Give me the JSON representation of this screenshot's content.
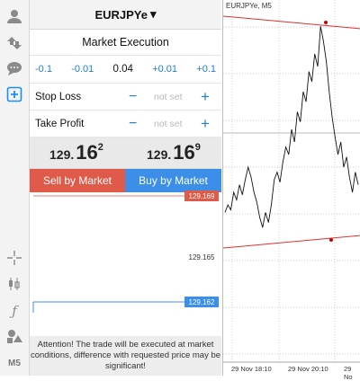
{
  "toolbar": {
    "icons": [
      "user-icon",
      "transfer-icon",
      "chat-icon",
      "new-order-icon",
      "crosshair-icon",
      "candles-icon",
      "function-icon",
      "objects-icon"
    ],
    "timeframe": "M5"
  },
  "order": {
    "symbol": "EURJPYe",
    "dropdown_glyph": "▾",
    "execution": "Market Execution",
    "volume_steps": {
      "minus_big": "-0.1",
      "minus_small": "-0.01",
      "value": "0.04",
      "plus_small": "+0.01",
      "plus_big": "+0.1"
    },
    "stop_loss": {
      "label": "Stop Loss",
      "value": "not set",
      "minus": "−",
      "plus": "+"
    },
    "take_profit": {
      "label": "Take Profit",
      "value": "not set",
      "minus": "−",
      "plus": "+"
    },
    "bid": {
      "main": "129.",
      "big": "16",
      "sup": "2"
    },
    "ask": {
      "main": "129.",
      "big": "16",
      "sup": "9"
    },
    "sell_label": "Sell by Market",
    "buy_label": "Buy by Market",
    "mini_levels": {
      "ask": "129.169",
      "mid": "129.165",
      "bid": "129.162"
    },
    "notice": "Attention! The trade will be executed at market conditions, difference with requested price may be significant!"
  },
  "colors": {
    "sell": "#e05a4a",
    "buy": "#3b8fe8",
    "accent": "#1a7fd9"
  },
  "chart": {
    "title": "EURJPYe, M5",
    "x_labels": [
      "29 Nov 18:10",
      "29 Nov 20:10",
      "29 No"
    ]
  },
  "chart_data": {
    "type": "line",
    "title": "EURJPYe, M5",
    "x_ticks": [
      "29 Nov 18:10",
      "29 Nov 20:10"
    ],
    "series": [
      {
        "values": [
          0.22,
          0.25,
          0.23,
          0.3,
          0.27,
          0.33,
          0.29,
          0.35,
          0.4,
          0.36,
          0.3,
          0.26,
          0.2,
          0.16,
          0.22,
          0.18,
          0.25,
          0.35,
          0.38,
          0.34,
          0.42,
          0.48,
          0.45,
          0.55,
          0.5,
          0.62,
          0.58,
          0.7,
          0.66,
          0.78,
          0.74,
          0.85,
          0.8,
          0.96,
          0.9,
          0.82,
          0.7,
          0.6,
          0.52,
          0.45,
          0.5,
          0.4,
          0.44,
          0.36,
          0.3,
          0.38,
          0.33
        ]
      }
    ],
    "trend_lines": 2
  }
}
